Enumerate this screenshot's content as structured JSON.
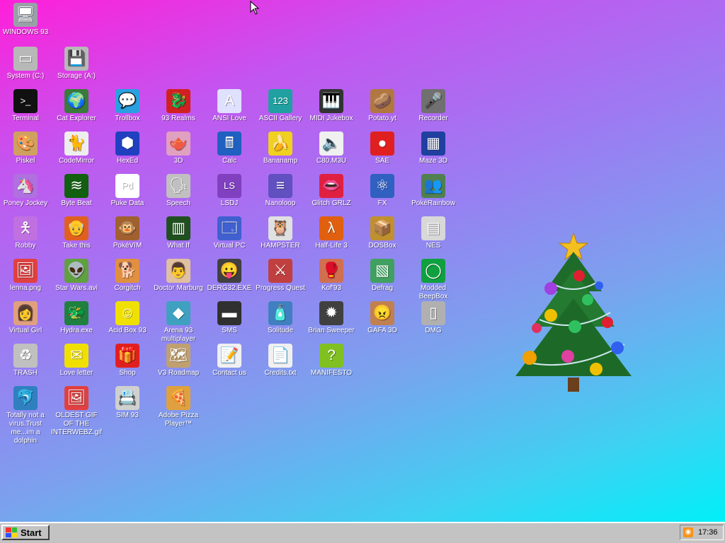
{
  "desktop": {
    "background_colors": [
      "#ff1fd9",
      "#9a7df2",
      "#00f0f8"
    ],
    "icons": [
      {
        "label": "WINDOWS 93",
        "icon": "computer-icon",
        "glyph": "🖥",
        "bg": "#9aa0a8"
      },
      {
        "label": "System (C:)",
        "icon": "hard-drive-icon",
        "glyph": "▭",
        "bg": "#b8b8b8"
      },
      {
        "label": "Storage (A:)",
        "icon": "floppy-drive-icon",
        "glyph": "💾",
        "bg": "#b8b8b8"
      },
      {
        "label": "Terminal",
        "icon": "terminal-icon",
        "glyph": ">_",
        "bg": "#111111"
      },
      {
        "label": "Cat Explorer",
        "icon": "cat-globe-icon",
        "glyph": "🌍",
        "bg": "#3a7a3a"
      },
      {
        "label": "Trollbox",
        "icon": "chat-bubble-icon",
        "glyph": "💬",
        "bg": "#2aa0e0"
      },
      {
        "label": "93 Realms",
        "icon": "dragon-icon",
        "glyph": "🐉",
        "bg": "#d02020"
      },
      {
        "label": "ANSI Love",
        "icon": "ansi-letter-icon",
        "glyph": "A",
        "bg": "#e0e0ff"
      },
      {
        "label": "ASCII Gallery",
        "icon": "ascii-numbers-icon",
        "glyph": "123",
        "bg": "#20a0a0"
      },
      {
        "label": "MIDI Jukebox",
        "icon": "piano-keys-icon",
        "glyph": "🎹",
        "bg": "#333333"
      },
      {
        "label": "Potato.yt",
        "icon": "potato-icon",
        "glyph": "🥔",
        "bg": "#b07840"
      },
      {
        "label": "Recorder",
        "icon": "microphone-icon",
        "glyph": "🎤",
        "bg": "#707070"
      },
      {
        "label": "Piskel",
        "icon": "palette-icon",
        "glyph": "🎨",
        "bg": "#d0a060"
      },
      {
        "label": "CodeMirror",
        "icon": "mirror-cat-icon",
        "glyph": "🐈",
        "bg": "#eeeeee"
      },
      {
        "label": "HexEd",
        "icon": "hex-cube-icon",
        "glyph": "⬢",
        "bg": "#2040c0"
      },
      {
        "label": "3D",
        "icon": "teapot-icon",
        "glyph": "🫖",
        "bg": "#e0a0c0"
      },
      {
        "label": "Calc",
        "icon": "calculator-icon",
        "glyph": "🖩",
        "bg": "#2060c0"
      },
      {
        "label": "Bananamp",
        "icon": "banana-icon",
        "glyph": "🍌",
        "bg": "#f0d020"
      },
      {
        "label": "C80.M3U",
        "icon": "speaker-file-icon",
        "glyph": "🔈",
        "bg": "#f0f0f0"
      },
      {
        "label": "SAE",
        "icon": "amiga-ball-icon",
        "glyph": "●",
        "bg": "#e02020"
      },
      {
        "label": "Maze 3D",
        "icon": "maze-icon",
        "glyph": "▦",
        "bg": "#2040a0"
      },
      {
        "label": "Poney Jockey",
        "icon": "pony-icon",
        "glyph": "🦄",
        "bg": "#b070e0"
      },
      {
        "label": "Byte Beat",
        "icon": "waveform-icon",
        "glyph": "≋",
        "bg": "#106010"
      },
      {
        "label": "Puke Data",
        "icon": "pd-icon",
        "glyph": "Pd",
        "bg": "#ffffff"
      },
      {
        "label": "Speech",
        "icon": "face-speech-icon",
        "glyph": "🗣",
        "bg": "#c0c0c0"
      },
      {
        "label": "LSDJ",
        "icon": "lsdj-icon",
        "glyph": "LS",
        "bg": "#8040c0"
      },
      {
        "label": "Nanoloop",
        "icon": "nanoloop-icon",
        "glyph": "≡",
        "bg": "#6050c0"
      },
      {
        "label": "Glitch GRLZ",
        "icon": "lips-icon",
        "glyph": "👄",
        "bg": "#e02040"
      },
      {
        "label": "FX",
        "icon": "atom-icon",
        "glyph": "⚛",
        "bg": "#3060c0"
      },
      {
        "label": "PokéRainbow",
        "icon": "pokemon-trainers-icon",
        "glyph": "👥",
        "bg": "#508050"
      },
      {
        "label": "Robby",
        "icon": "stick-figure-icon",
        "glyph": "🯅",
        "bg": "#c070e0"
      },
      {
        "label": "Take this",
        "icon": "old-man-icon",
        "glyph": "👴",
        "bg": "#e06020"
      },
      {
        "label": "PokéVIM",
        "icon": "pokeball-brown-icon",
        "glyph": "🐵",
        "bg": "#a06030"
      },
      {
        "label": "What If",
        "icon": "terminal-green-icon",
        "glyph": "▥",
        "bg": "#205020"
      },
      {
        "label": "Virtual PC",
        "icon": "window-icon",
        "glyph": "🗔",
        "bg": "#4060d0"
      },
      {
        "label": "HAMPSTER",
        "icon": "owl-icon",
        "glyph": "🦉",
        "bg": "#e0e0e0"
      },
      {
        "label": "Half-Life 3",
        "icon": "lambda-icon",
        "glyph": "λ",
        "bg": "#e06010"
      },
      {
        "label": "DOSBox",
        "icon": "dosbox-icon",
        "glyph": "📦",
        "bg": "#c09030"
      },
      {
        "label": "NES",
        "icon": "nes-console-icon",
        "glyph": "▤",
        "bg": "#d8d8d8"
      },
      {
        "label": "lenna.png",
        "icon": "image-file-icon",
        "glyph": "🖼",
        "bg": "#e04040"
      },
      {
        "label": "Star Wars.avi",
        "icon": "yoda-icon",
        "glyph": "👽",
        "bg": "#60a040"
      },
      {
        "label": "Corgitch",
        "icon": "corgi-icon",
        "glyph": "🐕",
        "bg": "#e09040"
      },
      {
        "label": "Doctor Marburg",
        "icon": "doctor-icon",
        "glyph": "👨",
        "bg": "#e0c0a0"
      },
      {
        "label": "DERG32.EXE",
        "icon": "monitor-face-icon",
        "glyph": "😛",
        "bg": "#404040"
      },
      {
        "label": "Progress Quest",
        "icon": "crossed-swords-icon",
        "glyph": "⚔",
        "bg": "#c04040"
      },
      {
        "label": "Kof'93",
        "icon": "fighter-face-icon",
        "glyph": "🥊",
        "bg": "#d07050"
      },
      {
        "label": "Defrag",
        "icon": "defrag-icon",
        "glyph": "▧",
        "bg": "#40a060"
      },
      {
        "label": "Modded BeepBox",
        "icon": "green-ring-icon",
        "glyph": "◯",
        "bg": "#10a040"
      },
      {
        "label": "Virtual Girl",
        "icon": "girl-face-icon",
        "glyph": "👩",
        "bg": "#e0a080"
      },
      {
        "label": "Hydra.exe",
        "icon": "hydra-icon",
        "glyph": "🐲",
        "bg": "#208040"
      },
      {
        "label": "Acid Box 93",
        "icon": "smiley-icon",
        "glyph": "☺",
        "bg": "#f0e000"
      },
      {
        "label": "Arena 93 multiplayer",
        "icon": "cube-icon",
        "glyph": "◆",
        "bg": "#40a0c0"
      },
      {
        "label": "SMS",
        "icon": "sms-console-icon",
        "glyph": "▬",
        "bg": "#303030"
      },
      {
        "label": "Solitude",
        "icon": "bottle-icon",
        "glyph": "🧴",
        "bg": "#4080c0"
      },
      {
        "label": "Brian Sweeper",
        "icon": "mine-icon",
        "glyph": "✹",
        "bg": "#404040"
      },
      {
        "label": "GAFA 3D",
        "icon": "doom-face-icon",
        "glyph": "😠",
        "bg": "#c08050"
      },
      {
        "label": "DMG",
        "icon": "gameboy-icon",
        "glyph": "▯",
        "bg": "#b0b0b0"
      },
      {
        "label": "TRASH",
        "icon": "recycle-bin-icon",
        "glyph": "♻",
        "bg": "#c0c0c0"
      },
      {
        "label": "Love letter",
        "icon": "envelope-icon",
        "glyph": "✉",
        "bg": "#f0e000"
      },
      {
        "label": "Shop",
        "icon": "gift-icon",
        "glyph": "🎁",
        "bg": "#e02020"
      },
      {
        "label": "V3 Roadmap",
        "icon": "map-icon",
        "glyph": "🗺",
        "bg": "#c0a070"
      },
      {
        "label": "Contact us",
        "icon": "contact-note-icon",
        "glyph": "📝",
        "bg": "#f0f0f0"
      },
      {
        "label": "Credits.txt",
        "icon": "text-file-icon",
        "glyph": "📄",
        "bg": "#f0f0f0"
      },
      {
        "label": "MANIFESTO",
        "icon": "question-mark-icon",
        "glyph": "?",
        "bg": "#80c020"
      },
      {
        "label": "Totally not a virus.Trust me...im a dolphin",
        "icon": "dolphin-shortcut-icon",
        "glyph": "🐬",
        "bg": "#3080c0"
      },
      {
        "label": "OLDEST GIF OF THE INTERWEBZ.gif",
        "icon": "image-file-icon",
        "glyph": "🖼",
        "bg": "#e04040"
      },
      {
        "label": "SIM 93",
        "icon": "sim-card-icon",
        "glyph": "📇",
        "bg": "#d0d0d0"
      },
      {
        "label": "Adobe Pizza Player™",
        "icon": "pizza-icon",
        "glyph": "🍕",
        "bg": "#e0a040"
      }
    ]
  },
  "taskbar": {
    "start_label": "Start",
    "clock": "17:36",
    "tray_icon": "rss-icon",
    "colors": {
      "bar": "#c3c3c3",
      "rss": "#f7931a"
    }
  }
}
